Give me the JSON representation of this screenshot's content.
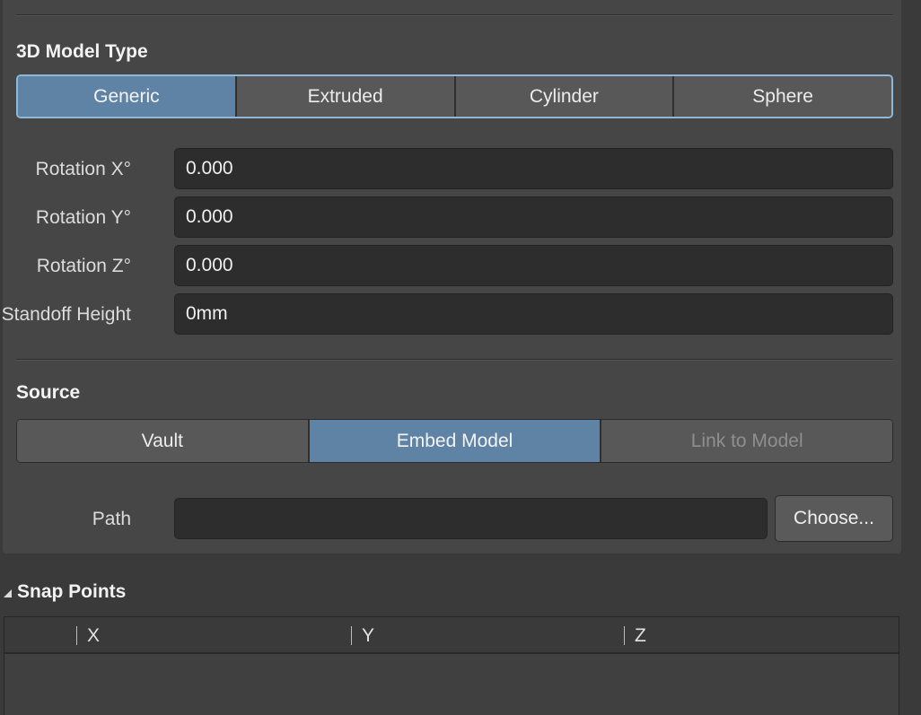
{
  "model_type": {
    "title": "3D Model Type",
    "options": [
      "Generic",
      "Extruded",
      "Cylinder",
      "Sphere"
    ],
    "selected": "Generic"
  },
  "fields": {
    "rotation_x": {
      "label": "Rotation X°",
      "value": "0.000"
    },
    "rotation_y": {
      "label": "Rotation Y°",
      "value": "0.000"
    },
    "rotation_z": {
      "label": "Rotation Z°",
      "value": "0.000"
    },
    "standoff_height": {
      "label": "Standoff Height",
      "value": "0mm"
    }
  },
  "source": {
    "title": "Source",
    "options": [
      "Vault",
      "Embed Model",
      "Link to Model"
    ],
    "selected": "Embed Model",
    "disabled": "Link to Model"
  },
  "path": {
    "label": "Path",
    "value": "",
    "choose_label": "Choose..."
  },
  "snap_points": {
    "title": "Snap Points",
    "columns": [
      "X",
      "Y",
      "Z"
    ]
  },
  "colors": {
    "active_segment": "#5f83a5",
    "focus_border": "#8fb7d8",
    "panel_bg": "#464646",
    "field_bg": "#2d2d2d"
  }
}
